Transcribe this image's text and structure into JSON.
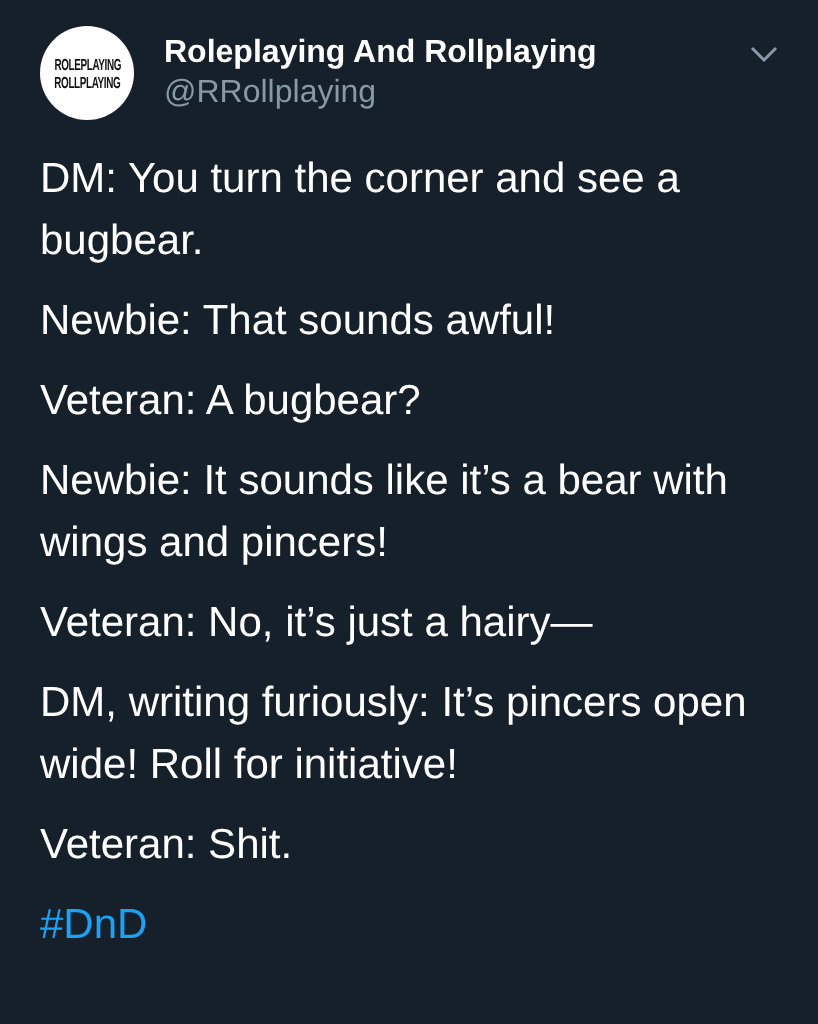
{
  "author": {
    "avatar_lines": [
      "ROLEPLAYING",
      "ROLLPLAYING"
    ],
    "name": "Roleplaying And Rollplaying",
    "handle": "@RRollplaying"
  },
  "paragraphs": [
    {
      "kind": "text",
      "text": "DM: You turn the corner and see a bugbear."
    },
    {
      "kind": "text",
      "text": "Newbie: That sounds awful!"
    },
    {
      "kind": "text",
      "text": "Veteran: A bugbear?"
    },
    {
      "kind": "text",
      "text": "Newbie: It sounds like it’s a bear with wings and pincers!"
    },
    {
      "kind": "text",
      "text": "Veteran: No, it’s just a hairy—"
    },
    {
      "kind": "text",
      "text": "DM, writing furiously: It’s pincers open wide! Roll for initiative!"
    },
    {
      "kind": "text",
      "text": "Veteran: Shit."
    },
    {
      "kind": "hashtag",
      "text": "#DnD"
    }
  ]
}
